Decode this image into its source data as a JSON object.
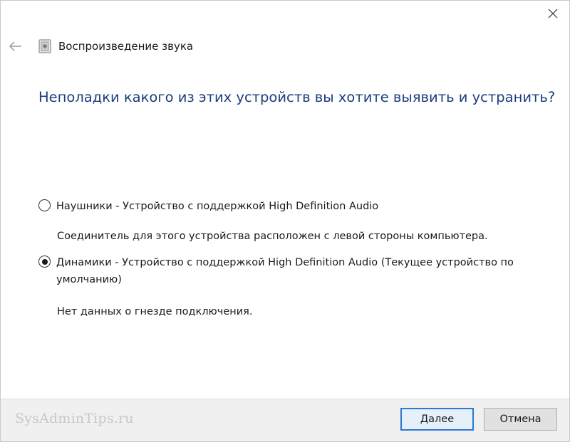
{
  "window": {
    "title": "Воспроизведение звука",
    "close_icon": "close-icon",
    "back_icon": "back-arrow-icon",
    "app_icon": "speaker-app-icon"
  },
  "main": {
    "heading": "Неполадки какого из этих устройств вы хотите выявить и устранить?",
    "options": [
      {
        "label": "Наушники - Устройство с поддержкой High Definition Audio",
        "description": "Соединитель для этого устройства расположен с левой стороны компьютера.",
        "selected": false
      },
      {
        "label": "Динамики - Устройство с поддержкой High Definition Audio (Текущее устройство по умолчанию)",
        "description": "Нет данных о гнезде подключения.",
        "selected": true
      }
    ]
  },
  "footer": {
    "watermark": "SysAdminTips.ru",
    "next_label": "Далее",
    "cancel_label": "Отмена"
  },
  "colors": {
    "heading": "#1e3d7b",
    "default_button_border": "#2a78d6",
    "footer_bg": "#f0f0f0"
  }
}
